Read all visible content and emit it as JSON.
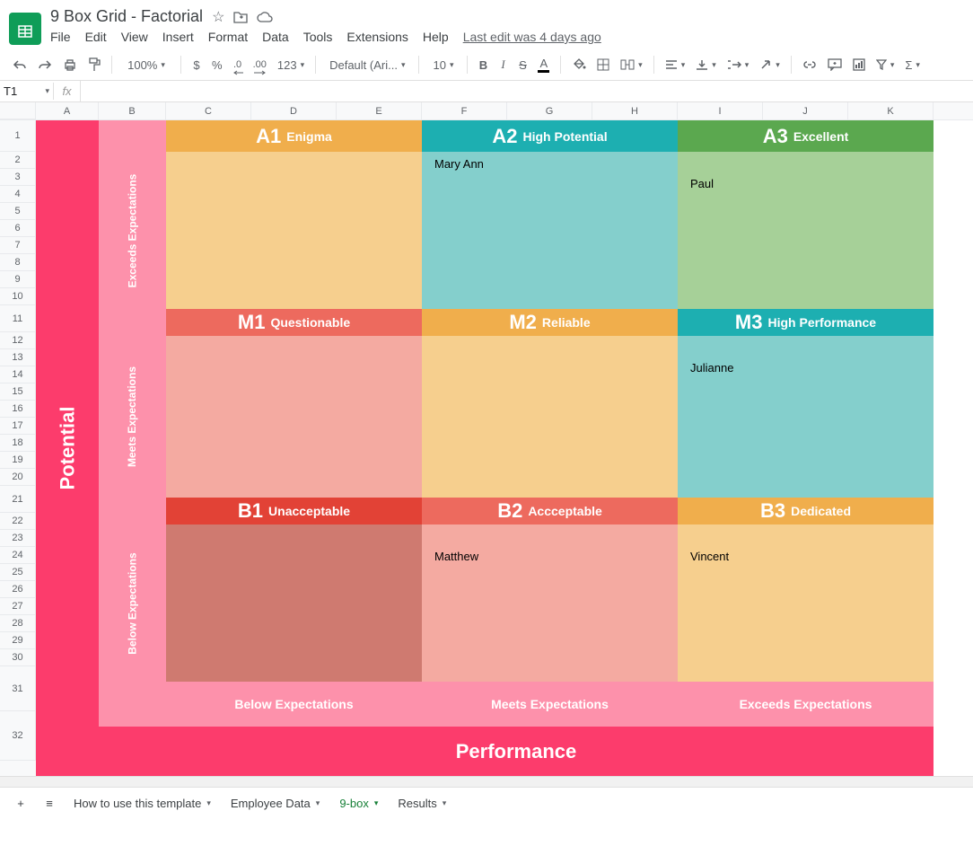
{
  "header": {
    "title": "9 Box Grid - Factorial",
    "menus": [
      "File",
      "Edit",
      "View",
      "Insert",
      "Format",
      "Data",
      "Tools",
      "Extensions",
      "Help"
    ],
    "last_edit": "Last edit was 4 days ago"
  },
  "toolbar": {
    "zoom": "100%",
    "currency": "$",
    "percent": "%",
    "dec_dec": ".0",
    "dec_inc": ".00",
    "more_formats": "123",
    "font": "Default (Ari...",
    "font_size": "10"
  },
  "formula_bar": {
    "name_box": "T1",
    "fx": ""
  },
  "columns": [
    "A",
    "B",
    "C",
    "D",
    "E",
    "F",
    "G",
    "H",
    "I",
    "J",
    "K"
  ],
  "rows": [
    "1",
    "2",
    "3",
    "4",
    "5",
    "6",
    "7",
    "8",
    "9",
    "10",
    "11",
    "12",
    "13",
    "14",
    "15",
    "16",
    "17",
    "18",
    "19",
    "20",
    "21",
    "22",
    "23",
    "24",
    "25",
    "26",
    "27",
    "28",
    "29",
    "30",
    "31",
    "32"
  ],
  "ninebox": {
    "y_axis": "Potential",
    "x_axis": "Performance",
    "y_labels": [
      "Exceeds Expectations",
      "Meets Expectations",
      "Below Expectations"
    ],
    "x_labels": [
      "Below Expectations",
      "Meets Expectations",
      "Exceeds Expectations"
    ],
    "cells": {
      "a1": {
        "code": "A1",
        "label": "Enigma",
        "hdr": "#f0ae4c",
        "body": "#f6cf8e",
        "content": ""
      },
      "a2": {
        "code": "A2",
        "label": "High Potential",
        "hdr": "#1dafb1",
        "body": "#84cfcc",
        "content": "Mary Ann"
      },
      "a3": {
        "code": "A3",
        "label": "Excellent",
        "hdr": "#5ba84f",
        "body": "#a6d098",
        "content": "Paul"
      },
      "m1": {
        "code": "M1",
        "label": "Questionable",
        "hdr": "#ed6a5e",
        "body": "#f4aaa1",
        "content": ""
      },
      "m2": {
        "code": "M2",
        "label": "Reliable",
        "hdr": "#f0ae4c",
        "body": "#f6cf8e",
        "content": ""
      },
      "m3": {
        "code": "M3",
        "label": "High Performance",
        "hdr": "#1dafb1",
        "body": "#84cfcc",
        "content": "Julianne"
      },
      "b1": {
        "code": "B1",
        "label": "Unacceptable",
        "hdr": "#e24236",
        "body": "#cf7a70",
        "content": ""
      },
      "b2": {
        "code": "B2",
        "label": "Accceptable",
        "hdr": "#ed6a5e",
        "body": "#f4aaa1",
        "content": "Matthew"
      },
      "b3": {
        "code": "B3",
        "label": "Dedicated",
        "hdr": "#f0ae4c",
        "body": "#f6cf8e",
        "content": "Vincent"
      }
    }
  },
  "tabs": {
    "items": [
      "How to use this template",
      "Employee Data",
      "9-box",
      "Results"
    ],
    "active": "9-box"
  }
}
